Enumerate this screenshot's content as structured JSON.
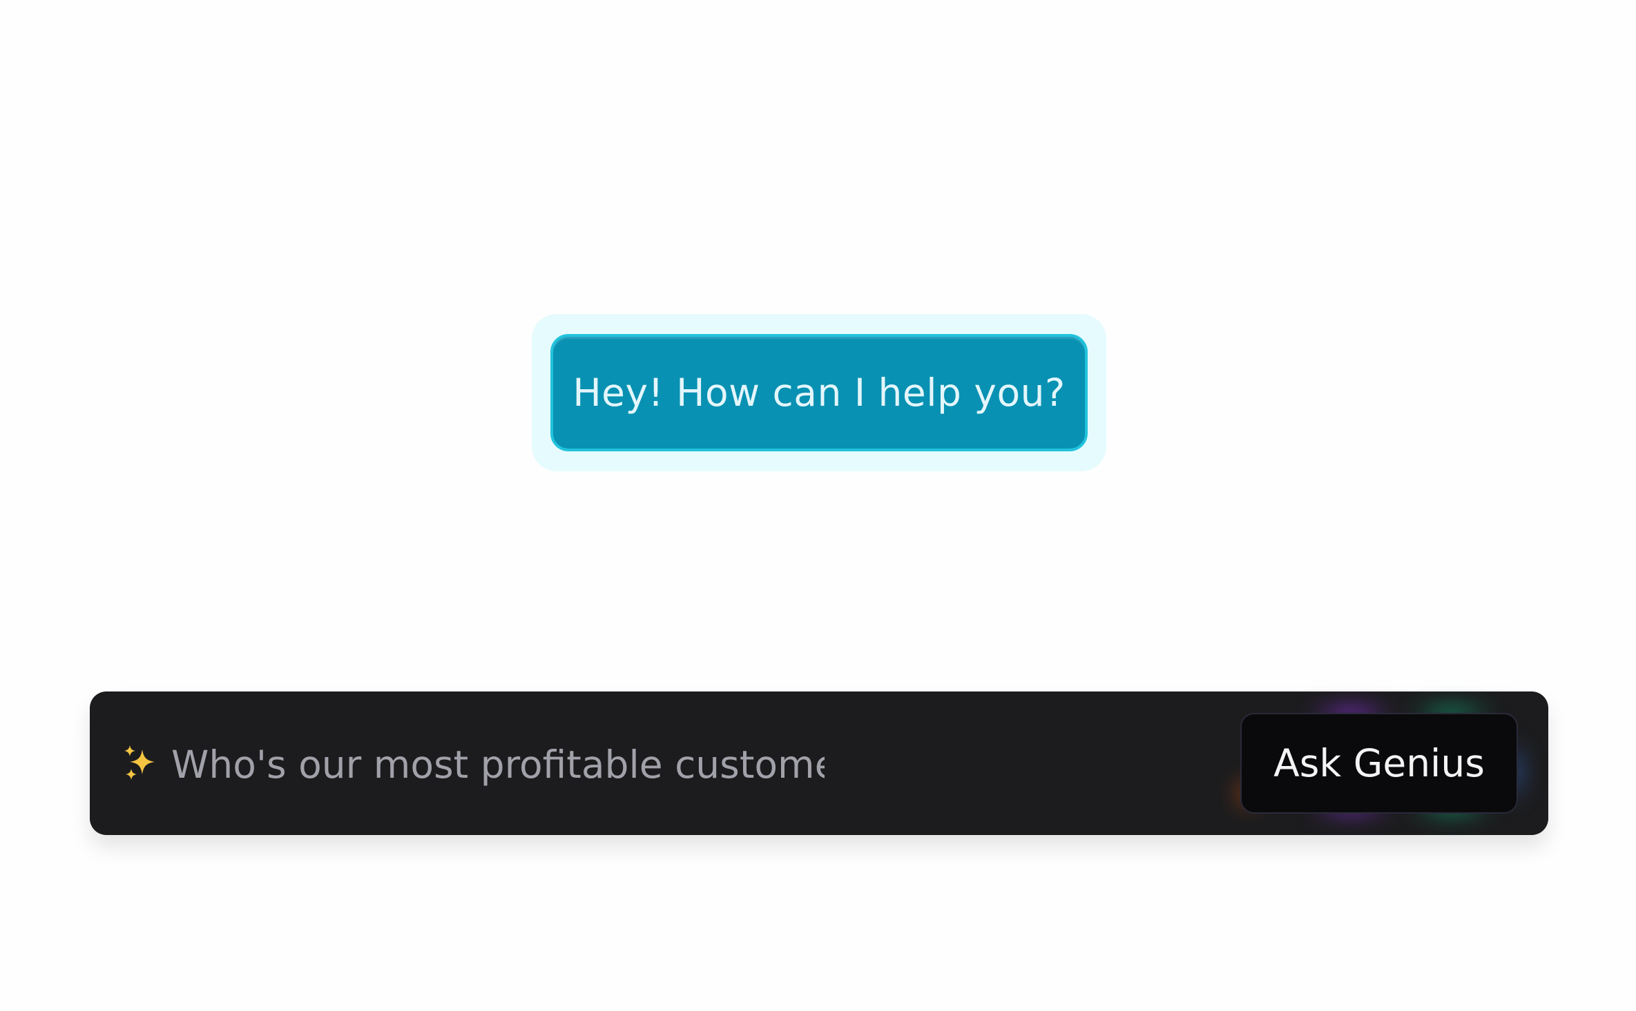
{
  "greeting": {
    "text": "Hey! How can I help you?"
  },
  "ask_bar": {
    "icon": "sparkles-icon",
    "prompt_value": "Who's our most profitable customer",
    "button_label": "Ask Genius"
  },
  "colors": {
    "bubble": "#0891b2",
    "bubble_halo": "#e6fbfe",
    "bar": "#1c1c1e",
    "button": "#0a0a0c"
  }
}
